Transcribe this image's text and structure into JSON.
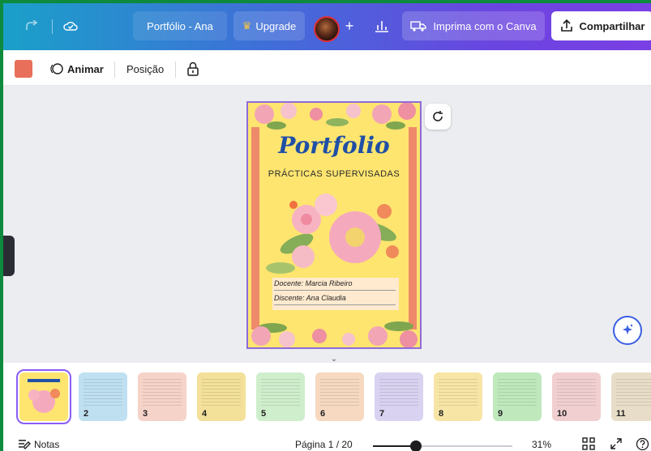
{
  "topbar": {
    "title": "Portfólio - Ana",
    "upgrade_label": "Upgrade",
    "upgrade_icon": "crown-icon",
    "plus_label": "+",
    "print_label": "Imprima com o Canva",
    "share_label": "Compartilhar"
  },
  "toolbar": {
    "color": "#e8705a",
    "animate_label": "Animar",
    "position_label": "Posição"
  },
  "page": {
    "title": "Portfolio",
    "subtitle": "PRÁCTICAS SUPERVISADAS",
    "line1": "Docente: Marcia Ribeiro",
    "line2": "Discente: Ana Claudia"
  },
  "thumbnails": [
    {
      "num": "",
      "color": "#fde56f",
      "selected": true
    },
    {
      "num": "2",
      "color": "#bfe0f1"
    },
    {
      "num": "3",
      "color": "#f6d3c9"
    },
    {
      "num": "4",
      "color": "#f3e19a"
    },
    {
      "num": "5",
      "color": "#cfeecc"
    },
    {
      "num": "6",
      "color": "#f6d9c0"
    },
    {
      "num": "7",
      "color": "#d9d2f0"
    },
    {
      "num": "8",
      "color": "#f7e5a6"
    },
    {
      "num": "9",
      "color": "#bfe9bd"
    },
    {
      "num": "10",
      "color": "#f1cfd0"
    },
    {
      "num": "11",
      "color": "#e8ddc8"
    }
  ],
  "status": {
    "notes_label": "Notas",
    "page_indicator": "Página 1 / 20",
    "zoom_label": "31%",
    "zoom_fraction": 0.31
  },
  "colors": {
    "accent": "#8b5cf6",
    "frame": "#0e8a3e"
  }
}
